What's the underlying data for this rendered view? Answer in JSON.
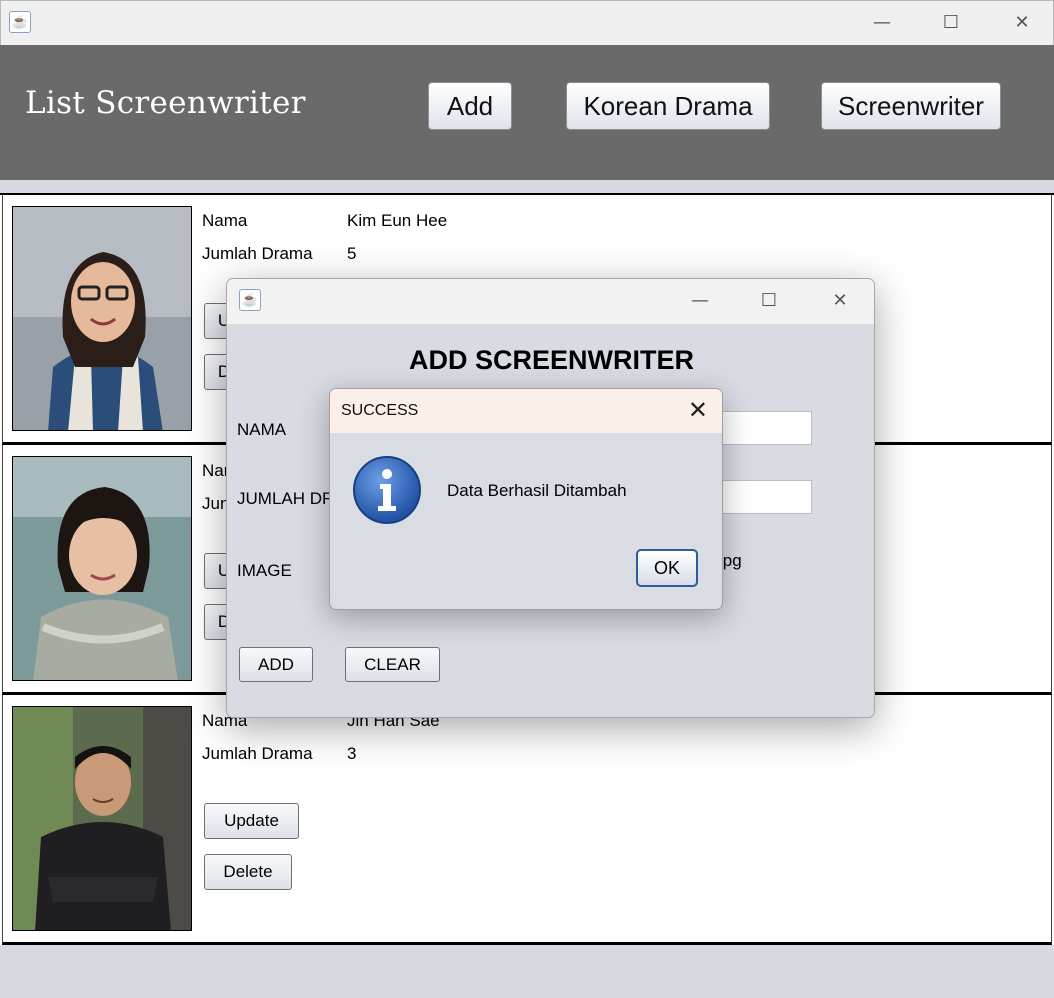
{
  "window": {
    "icon": "java-icon",
    "controls": {
      "minimize": "—",
      "maximize": "☐",
      "close": "✕"
    }
  },
  "header": {
    "title": "List Screenwriter",
    "buttons": {
      "add": "Add",
      "korean_drama": "Korean Drama",
      "screenwriter": "Screenwriter"
    }
  },
  "list": {
    "field_labels": {
      "name": "Nama",
      "count": "Jumlah Drama"
    },
    "actions": {
      "update": "Update",
      "delete": "Delete"
    },
    "items": [
      {
        "name": "Kim Eun Hee",
        "count": "5",
        "partial_update": "U",
        "partial_delete": "D"
      },
      {
        "partial_name_label": "Nar",
        "partial_count_label": "Jun",
        "partial_update": "U",
        "partial_delete": "D"
      },
      {
        "name": "Jin Han Sae",
        "count": "3"
      }
    ]
  },
  "add_dialog": {
    "title": "ADD SCREENWRITER",
    "labels": {
      "name": "NAMA",
      "count": "JUMLAH DR",
      "image": "IMAGE"
    },
    "image_value_partial": "jpg",
    "buttons": {
      "add": "ADD",
      "clear": "CLEAR"
    }
  },
  "message_dialog": {
    "title": "SUCCESS",
    "icon": "info-icon",
    "text": "Data Berhasil Ditambah",
    "ok": "OK",
    "close": "✕"
  },
  "colors": {
    "header_bg": "#6a6a6a",
    "info_blue": "#2f62b8",
    "dialog_bg": "#d8dbe2"
  }
}
